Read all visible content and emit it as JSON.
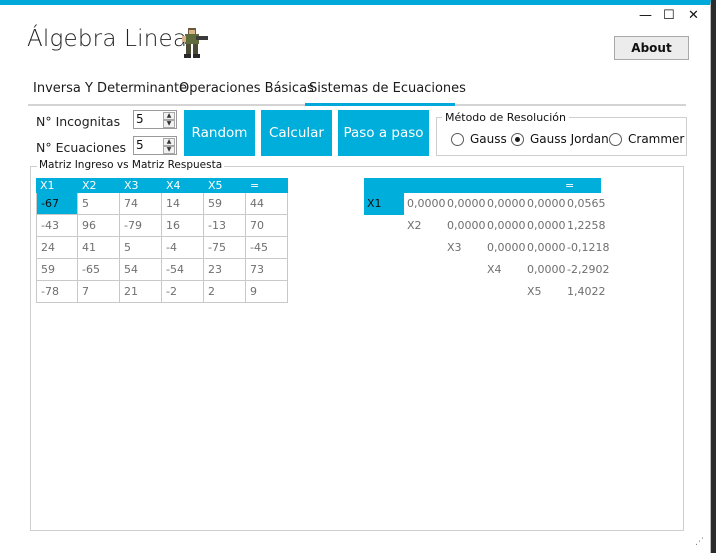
{
  "window": {
    "title": "Álgebra Lineal",
    "controls": {
      "minimize": "—",
      "maximize": "☐",
      "close": "✕"
    },
    "about_label": "About",
    "logo_icon": "pixel-soldier-icon",
    "accent": "#00aedb"
  },
  "tabs": [
    {
      "label": "Inversa Y Determinante",
      "active": false
    },
    {
      "label": "Operaciones Básicas",
      "active": false
    },
    {
      "label": "Sistemas de Ecuaciones",
      "active": true
    }
  ],
  "inputs": {
    "incognitas_label": "N° Incognitas",
    "incognitas_value": "5",
    "ecuaciones_label": "N° Ecuaciones",
    "ecuaciones_value": "5"
  },
  "buttons": {
    "random": "Random",
    "calcular": "Calcular",
    "paso": "Paso a paso"
  },
  "method": {
    "title": "Método de Resolución",
    "options": [
      {
        "label": "Gauss",
        "selected": false
      },
      {
        "label": "Gauss Jordan",
        "selected": true
      },
      {
        "label": "Crammer",
        "selected": false
      }
    ]
  },
  "matrix_panel": {
    "title": "Matriz Ingreso vs Matriz Respuesta",
    "input_headers": [
      "X1",
      "X2",
      "X3",
      "X4",
      "X5",
      "="
    ],
    "input_rows": [
      [
        "-67",
        "5",
        "74",
        "14",
        "59",
        "44"
      ],
      [
        "-43",
        "96",
        "-79",
        "16",
        "-13",
        "70"
      ],
      [
        "24",
        "41",
        "5",
        "-4",
        "-75",
        "-45"
      ],
      [
        "59",
        "-65",
        "54",
        "-54",
        "23",
        "73"
      ],
      [
        "-78",
        "7",
        "21",
        "-2",
        "2",
        "9"
      ]
    ],
    "result_header_eq": "=",
    "result_rows": [
      [
        "X1",
        "0,0000",
        "0,0000",
        "0,0000",
        "0,0000",
        "0,0565"
      ],
      [
        "",
        "X2",
        "0,0000",
        "0,0000",
        "0,0000",
        "1,2258"
      ],
      [
        "",
        "",
        "X3",
        "0,0000",
        "0,0000",
        "-0,1218"
      ],
      [
        "",
        "",
        "",
        "X4",
        "0,0000",
        "-2,2902"
      ],
      [
        "",
        "",
        "",
        "",
        "X5",
        "1,4022"
      ]
    ]
  }
}
